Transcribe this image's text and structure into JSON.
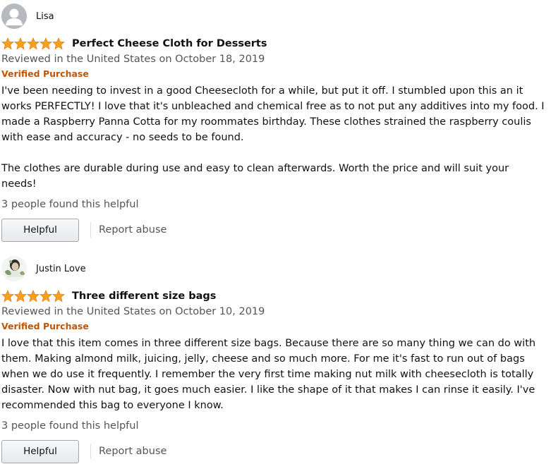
{
  "reviews": [
    {
      "reviewer": "Lisa",
      "rating": 5,
      "title": "Perfect Cheese Cloth for Desserts",
      "date": "Reviewed in the United States on October 18, 2019",
      "verified": "Verified Purchase",
      "body_paragraphs": [
        "I've been needing to invest in a good Cheesecloth for a while, but put it off. I stumbled upon this an it works PERFECTLY! I love that it's unbleached and chemical free as to not put any additives into my food. I made a Raspberry Panna Cotta for my roommates birthday. These clothes strained the raspberry coulis with ease and accuracy - no seeds to be found.",
        "The clothes are durable during use and easy to clean afterwards. Worth the price and will suit your needs!"
      ],
      "helpful_count": "3 people found this helpful",
      "helpful_label": "Helpful",
      "report_label": "Report abuse"
    },
    {
      "reviewer": "Justin Love",
      "rating": 5,
      "title": "Three different size bags",
      "date": "Reviewed in the United States on October 10, 2019",
      "verified": "Verified Purchase",
      "body_paragraphs": [
        "I love that this item comes in three different size bags. Because there are so many thing we can do with them. Making almond milk, juicing, jelly, cheese and so much more. For me it's fast to run out of bags when we do use it frequently. I remember the very first time making nut milk with cheesecloth is totally disaster. Now with nut bag, it goes much easier. I like the shape of it that makes I can rinse it easily. I've recommended this bag to everyone I know."
      ],
      "helpful_count": "3 people found this helpful",
      "helpful_label": "Helpful",
      "report_label": "Report abuse"
    }
  ],
  "colors": {
    "star": "#f7a01d",
    "star_edge": "#e47911",
    "verified": "#c45500",
    "muted_text": "#555555"
  },
  "icons": {
    "rating_star": "star-icon",
    "default_avatar": "person-silhouette-icon"
  }
}
